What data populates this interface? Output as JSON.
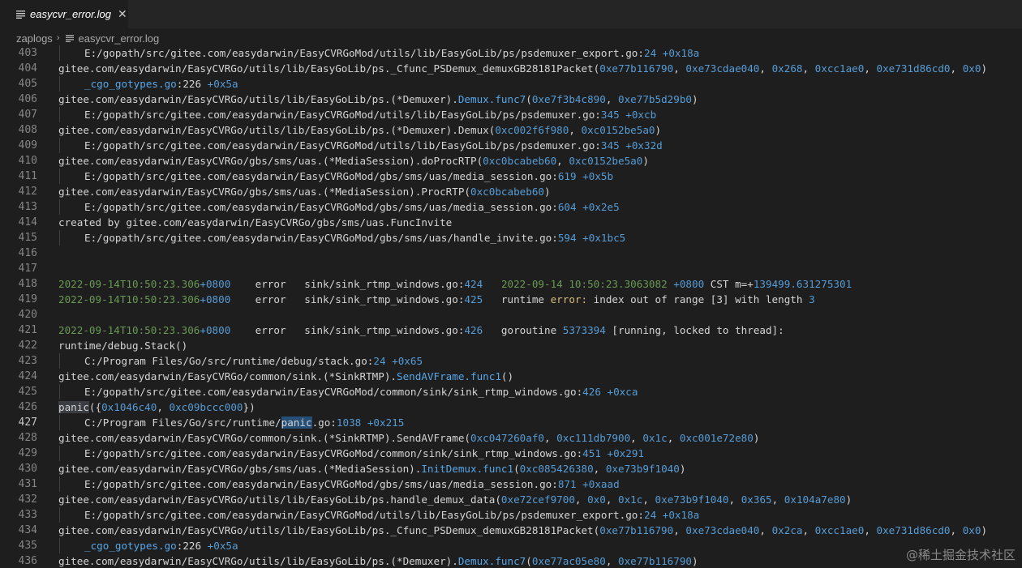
{
  "tab": {
    "label": "easycvr_error.log",
    "close_glyph": "✕"
  },
  "breadcrumb": {
    "folder": "zaplogs",
    "separator": "›",
    "file": "easycvr_error.log"
  },
  "watermark": "@稀土掘金技术社区",
  "lines": [
    {
      "n": "403",
      "indent": true,
      "segs": [
        [
          "",
          "E:/gopath/src/gitee.com/easydarwin/EasyCVRGoMod/utils/lib/EasyGoLib/ps/psdemuxer_export.go:"
        ],
        [
          "blue",
          "24"
        ],
        [
          "",
          " "
        ],
        [
          "blue",
          "+0x18a"
        ]
      ]
    },
    {
      "n": "404",
      "indent": false,
      "segs": [
        [
          "",
          "gitee.com/easydarwin/EasyCVRGo/utils/lib/EasyGoLib/ps._Cfunc_PSDemux_demuxGB28181Packet("
        ],
        [
          "blue",
          "0xe77b116790"
        ],
        [
          "",
          ", "
        ],
        [
          "blue",
          "0xe73cdae040"
        ],
        [
          "",
          ", "
        ],
        [
          "blue",
          "0x268"
        ],
        [
          "",
          ", "
        ],
        [
          "blue",
          "0xcc1ae0"
        ],
        [
          "",
          ", "
        ],
        [
          "blue",
          "0xe731d86cd0"
        ],
        [
          "",
          ", "
        ],
        [
          "blue",
          "0x0"
        ],
        [
          "",
          ")"
        ]
      ]
    },
    {
      "n": "405",
      "indent": true,
      "segs": [
        [
          "func",
          "_cgo_gotypes.go"
        ],
        [
          "",
          ":226 "
        ],
        [
          "blue",
          "+0x5a"
        ]
      ]
    },
    {
      "n": "406",
      "indent": false,
      "segs": [
        [
          "",
          "gitee.com/easydarwin/EasyCVRGo/utils/lib/EasyGoLib/ps.(*Demuxer)."
        ],
        [
          "func",
          "Demux.func7"
        ],
        [
          "",
          "("
        ],
        [
          "blue",
          "0xe7f3b4c890"
        ],
        [
          "",
          ", "
        ],
        [
          "blue",
          "0xe77b5d29b0"
        ],
        [
          "",
          ")"
        ]
      ]
    },
    {
      "n": "407",
      "indent": true,
      "segs": [
        [
          "",
          "E:/gopath/src/gitee.com/easydarwin/EasyCVRGoMod/utils/lib/EasyGoLib/ps/psdemuxer.go:"
        ],
        [
          "blue",
          "345"
        ],
        [
          "",
          " "
        ],
        [
          "blue",
          "+0xcb"
        ]
      ]
    },
    {
      "n": "408",
      "indent": false,
      "segs": [
        [
          "",
          "gitee.com/easydarwin/EasyCVRGo/utils/lib/EasyGoLib/ps.(*Demuxer).Demux("
        ],
        [
          "blue",
          "0xc002f6f980"
        ],
        [
          "",
          ", "
        ],
        [
          "blue",
          "0xc0152be5a0"
        ],
        [
          "",
          ")"
        ]
      ]
    },
    {
      "n": "409",
      "indent": true,
      "segs": [
        [
          "",
          "E:/gopath/src/gitee.com/easydarwin/EasyCVRGoMod/utils/lib/EasyGoLib/ps/psdemuxer.go:"
        ],
        [
          "blue",
          "345"
        ],
        [
          "",
          " "
        ],
        [
          "blue",
          "+0x32d"
        ]
      ]
    },
    {
      "n": "410",
      "indent": false,
      "segs": [
        [
          "",
          "gitee.com/easydarwin/EasyCVRGo/gbs/sms/uas.(*MediaSession).doProcRTP("
        ],
        [
          "blue",
          "0xc0bcabeb60"
        ],
        [
          "",
          ", "
        ],
        [
          "blue",
          "0xc0152be5a0"
        ],
        [
          "",
          ")"
        ]
      ]
    },
    {
      "n": "411",
      "indent": true,
      "segs": [
        [
          "",
          "E:/gopath/src/gitee.com/easydarwin/EasyCVRGoMod/gbs/sms/uas/media_session.go:"
        ],
        [
          "blue",
          "619"
        ],
        [
          "",
          " "
        ],
        [
          "blue",
          "+0x5b"
        ]
      ]
    },
    {
      "n": "412",
      "indent": false,
      "segs": [
        [
          "",
          "gitee.com/easydarwin/EasyCVRGo/gbs/sms/uas.(*MediaSession).ProcRTP("
        ],
        [
          "blue",
          "0xc0bcabeb60"
        ],
        [
          "",
          ")"
        ]
      ]
    },
    {
      "n": "413",
      "indent": true,
      "segs": [
        [
          "",
          "E:/gopath/src/gitee.com/easydarwin/EasyCVRGoMod/gbs/sms/uas/media_session.go:"
        ],
        [
          "blue",
          "604"
        ],
        [
          "",
          " "
        ],
        [
          "blue",
          "+0x2e5"
        ]
      ]
    },
    {
      "n": "414",
      "indent": false,
      "segs": [
        [
          "",
          "created by gitee.com/easydarwin/EasyCVRGo/gbs/sms/uas.FuncInvite"
        ]
      ]
    },
    {
      "n": "415",
      "indent": true,
      "segs": [
        [
          "",
          "E:/gopath/src/gitee.com/easydarwin/EasyCVRGoMod/gbs/sms/uas/handle_invite.go:"
        ],
        [
          "blue",
          "594"
        ],
        [
          "",
          " "
        ],
        [
          "blue",
          "+0x1bc5"
        ]
      ]
    },
    {
      "n": "416",
      "indent": false,
      "segs": []
    },
    {
      "n": "417",
      "indent": false,
      "segs": []
    },
    {
      "n": "418",
      "indent": false,
      "segs": [
        [
          "green",
          "2022-09-14T10:50:23.306"
        ],
        [
          "blue",
          "+0800"
        ],
        [
          "",
          "    error   sink/sink_rtmp_windows.go:"
        ],
        [
          "blue",
          "424"
        ],
        [
          "",
          "   "
        ],
        [
          "green",
          "2022-09-14 10:50:23.3063082"
        ],
        [
          "",
          " "
        ],
        [
          "blue",
          "+0800"
        ],
        [
          "",
          " CST m=+"
        ],
        [
          "blue",
          "139499.631275301"
        ]
      ]
    },
    {
      "n": "419",
      "indent": false,
      "segs": [
        [
          "green",
          "2022-09-14T10:50:23.306"
        ],
        [
          "blue",
          "+0800"
        ],
        [
          "",
          "    error   sink/sink_rtmp_windows.go:"
        ],
        [
          "blue",
          "425"
        ],
        [
          "",
          "   runtime "
        ],
        [
          "err-kw",
          "error:"
        ],
        [
          "",
          " index out of range [3] with length "
        ],
        [
          "blue",
          "3"
        ]
      ]
    },
    {
      "n": "420",
      "indent": false,
      "segs": []
    },
    {
      "n": "421",
      "indent": false,
      "segs": [
        [
          "green",
          "2022-09-14T10:50:23.306"
        ],
        [
          "blue",
          "+0800"
        ],
        [
          "",
          "    error   sink/sink_rtmp_windows.go:"
        ],
        [
          "blue",
          "426"
        ],
        [
          "",
          "   goroutine "
        ],
        [
          "blue",
          "5373394"
        ],
        [
          "",
          " [running, locked to thread]:"
        ]
      ]
    },
    {
      "n": "422",
      "indent": false,
      "segs": [
        [
          "",
          "runtime/debug.Stack()"
        ]
      ]
    },
    {
      "n": "423",
      "indent": true,
      "segs": [
        [
          "",
          "C:/Program Files/Go/src/runtime/debug/stack.go:"
        ],
        [
          "blue",
          "24"
        ],
        [
          "",
          " "
        ],
        [
          "blue",
          "+0x65"
        ]
      ]
    },
    {
      "n": "424",
      "indent": false,
      "segs": [
        [
          "",
          "gitee.com/easydarwin/EasyCVRGo/common/sink.(*SinkRTMP)."
        ],
        [
          "func",
          "SendAVFrame.func1"
        ],
        [
          "",
          "()"
        ]
      ]
    },
    {
      "n": "425",
      "indent": true,
      "segs": [
        [
          "",
          "E:/gopath/src/gitee.com/easydarwin/EasyCVRGoMod/common/sink/sink_rtmp_windows.go:"
        ],
        [
          "blue",
          "426"
        ],
        [
          "",
          " "
        ],
        [
          "blue",
          "+0xca"
        ]
      ]
    },
    {
      "n": "426",
      "indent": false,
      "segs": [
        [
          "hl2",
          "panic"
        ],
        [
          "",
          "({"
        ],
        [
          "blue",
          "0x1046c40"
        ],
        [
          "",
          ", "
        ],
        [
          "blue",
          "0xc09bccc000"
        ],
        [
          "",
          "})"
        ]
      ]
    },
    {
      "n": "427",
      "indent": true,
      "active": true,
      "segs": [
        [
          "",
          "C:/Program Files/Go/src/runtime/"
        ],
        [
          "hl",
          "panic"
        ],
        [
          "",
          ".go:"
        ],
        [
          "blue",
          "1038"
        ],
        [
          "",
          " "
        ],
        [
          "blue",
          "+0x215"
        ]
      ]
    },
    {
      "n": "428",
      "indent": false,
      "segs": [
        [
          "",
          "gitee.com/easydarwin/EasyCVRGo/common/sink.(*SinkRTMP).SendAVFrame("
        ],
        [
          "blue",
          "0xc047260af0"
        ],
        [
          "",
          ", "
        ],
        [
          "blue",
          "0xc111db7900"
        ],
        [
          "",
          ", "
        ],
        [
          "blue",
          "0x1c"
        ],
        [
          "",
          ", "
        ],
        [
          "blue",
          "0xc001e72e80"
        ],
        [
          "",
          ")"
        ]
      ]
    },
    {
      "n": "429",
      "indent": true,
      "segs": [
        [
          "",
          "E:/gopath/src/gitee.com/easydarwin/EasyCVRGoMod/common/sink/sink_rtmp_windows.go:"
        ],
        [
          "blue",
          "451"
        ],
        [
          "",
          " "
        ],
        [
          "blue",
          "+0x291"
        ]
      ]
    },
    {
      "n": "430",
      "indent": false,
      "segs": [
        [
          "",
          "gitee.com/easydarwin/EasyCVRGo/gbs/sms/uas.(*MediaSession)."
        ],
        [
          "func",
          "InitDemux.func1"
        ],
        [
          "",
          "("
        ],
        [
          "blue",
          "0xc085426380"
        ],
        [
          "",
          ", "
        ],
        [
          "blue",
          "0xe73b9f1040"
        ],
        [
          "",
          ")"
        ]
      ]
    },
    {
      "n": "431",
      "indent": true,
      "segs": [
        [
          "",
          "E:/gopath/src/gitee.com/easydarwin/EasyCVRGoMod/gbs/sms/uas/media_session.go:"
        ],
        [
          "blue",
          "871"
        ],
        [
          "",
          " "
        ],
        [
          "blue",
          "+0xaad"
        ]
      ]
    },
    {
      "n": "432",
      "indent": false,
      "segs": [
        [
          "",
          "gitee.com/easydarwin/EasyCVRGo/utils/lib/EasyGoLib/ps.handle_demux_data("
        ],
        [
          "blue",
          "0xe72cef9700"
        ],
        [
          "",
          ", "
        ],
        [
          "blue",
          "0x0"
        ],
        [
          "",
          ", "
        ],
        [
          "blue",
          "0x1c"
        ],
        [
          "",
          ", "
        ],
        [
          "blue",
          "0xe73b9f1040"
        ],
        [
          "",
          ", "
        ],
        [
          "blue",
          "0x365"
        ],
        [
          "",
          ", "
        ],
        [
          "blue",
          "0x104a7e80"
        ],
        [
          "",
          ")"
        ]
      ]
    },
    {
      "n": "433",
      "indent": true,
      "segs": [
        [
          "",
          "E:/gopath/src/gitee.com/easydarwin/EasyCVRGoMod/utils/lib/EasyGoLib/ps/psdemuxer_export.go:"
        ],
        [
          "blue",
          "24"
        ],
        [
          "",
          " "
        ],
        [
          "blue",
          "+0x18a"
        ]
      ]
    },
    {
      "n": "434",
      "indent": false,
      "segs": [
        [
          "",
          "gitee.com/easydarwin/EasyCVRGo/utils/lib/EasyGoLib/ps._Cfunc_PSDemux_demuxGB28181Packet("
        ],
        [
          "blue",
          "0xe77b116790"
        ],
        [
          "",
          ", "
        ],
        [
          "blue",
          "0xe73cdae040"
        ],
        [
          "",
          ", "
        ],
        [
          "blue",
          "0x2ca"
        ],
        [
          "",
          ", "
        ],
        [
          "blue",
          "0xcc1ae0"
        ],
        [
          "",
          ", "
        ],
        [
          "blue",
          "0xe731d86cd0"
        ],
        [
          "",
          ", "
        ],
        [
          "blue",
          "0x0"
        ],
        [
          "",
          ")"
        ]
      ]
    },
    {
      "n": "435",
      "indent": true,
      "segs": [
        [
          "func",
          "_cgo_gotypes.go"
        ],
        [
          "",
          ":226 "
        ],
        [
          "blue",
          "+0x5a"
        ]
      ]
    },
    {
      "n": "436",
      "indent": false,
      "segs": [
        [
          "",
          "gitee.com/easydarwin/EasyCVRGo/utils/lib/EasyGoLib/ps.(*Demuxer)."
        ],
        [
          "func",
          "Demux.func7"
        ],
        [
          "",
          "("
        ],
        [
          "blue",
          "0xe77ac05e80"
        ],
        [
          "",
          ", "
        ],
        [
          "blue",
          "0xe77b116790"
        ],
        [
          "",
          ")"
        ]
      ]
    }
  ]
}
